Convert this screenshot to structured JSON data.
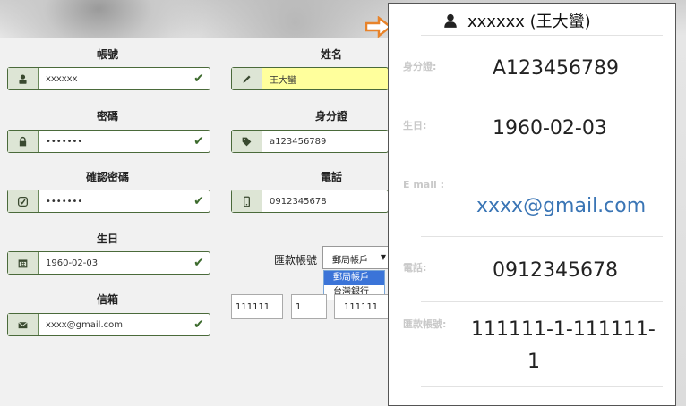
{
  "form": {
    "account": {
      "label": "帳號",
      "value": "xxxxxx"
    },
    "name": {
      "label": "姓名",
      "value": "王大蠻"
    },
    "password": {
      "label": "密碼",
      "value": "•••••••"
    },
    "id_number": {
      "label": "身分證",
      "value": "a123456789"
    },
    "confirm_password": {
      "label": "確認密碼",
      "value": "•••••••"
    },
    "phone": {
      "label": "電話",
      "value": "0912345678"
    },
    "birthday": {
      "label": "生日",
      "value": "1960-02-03"
    },
    "remit_account": {
      "label": "匯款帳號",
      "selected": "郵局帳戶",
      "options": [
        "郵局帳戶",
        "台灣銀行"
      ],
      "parts": [
        "111111",
        "1",
        "111111"
      ]
    },
    "email": {
      "label": "信箱",
      "value": "xxxx@gmail.com"
    }
  },
  "card": {
    "title": "xxxxxx (王大蠻)",
    "id_label": "身分證:",
    "id_value": "A123456789",
    "birth_label": "生日:",
    "birth_value": "1960-02-03",
    "email_label": "E mail :",
    "email_value": "xxxx@gmail.com",
    "phone_label": "電話:",
    "phone_value": "0912345678",
    "remit_label": "匯款帳號:",
    "remit_value_line1": "111111-1-111111-",
    "remit_value_line2": "1"
  },
  "colors": {
    "accent_green": "#3d6b2e",
    "link_blue": "#3a75b5",
    "arrow_orange": "#e8832a",
    "dropdown_highlight": "#3b74d8"
  }
}
